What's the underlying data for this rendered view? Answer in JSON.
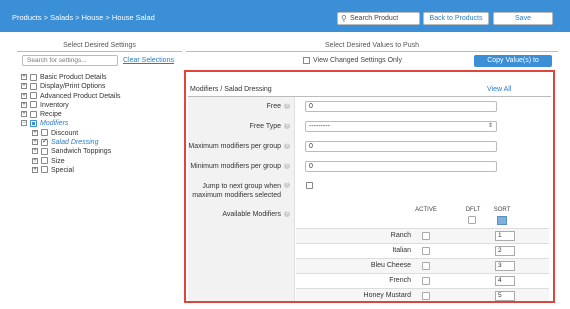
{
  "header": {
    "breadcrumb": "Products > Salads > House > House Salad",
    "search_label": "Search Product",
    "back_label": "Back to Products",
    "save_label": "Save"
  },
  "left": {
    "heading": "Select Desired Settings",
    "search_placeholder": "Search for settings...",
    "clear_label": "Clear Selections",
    "tree": [
      {
        "label": "Basic Product Details",
        "level": 0,
        "expander": "+",
        "state": "off"
      },
      {
        "label": "Display/Print Options",
        "level": 0,
        "expander": "+",
        "state": "off"
      },
      {
        "label": "Advanced Product Details",
        "level": 0,
        "expander": "+",
        "state": "off"
      },
      {
        "label": "Inventory",
        "level": 0,
        "expander": "+",
        "state": "off"
      },
      {
        "label": "Recipe",
        "level": 0,
        "expander": "+",
        "state": "off"
      },
      {
        "label": "Modifiers",
        "level": 0,
        "expander": "−",
        "state": "partial",
        "highlight": true
      },
      {
        "label": "Discount",
        "level": 1,
        "expander": "+",
        "state": "off"
      },
      {
        "label": "Salad Dressing",
        "level": 1,
        "expander": "+",
        "state": "checked",
        "highlight": true
      },
      {
        "label": "Sandwich Toppings",
        "level": 1,
        "expander": "+",
        "state": "off"
      },
      {
        "label": "Size",
        "level": 1,
        "expander": "+",
        "state": "off"
      },
      {
        "label": "Special",
        "level": 1,
        "expander": "+",
        "state": "off"
      }
    ]
  },
  "right": {
    "heading": "Select Desired Values to Push",
    "view_changed_label": "View Changed Settings Only",
    "copy_label": "Copy Value(s) to"
  },
  "panel": {
    "title": "Modifiers / Salad Dressing",
    "view_all": "View All",
    "fields": {
      "free_label": "Free",
      "free_value": "0",
      "free_type_label": "Free Type",
      "free_type_value": "---------",
      "max_label": "Maximum modifiers per group",
      "max_value": "0",
      "min_label": "Minimum modifiers per group",
      "min_value": "0",
      "jump_label_1": "Jump to next group when",
      "jump_label_2": "maximum modifiers selected",
      "available_label": "Available Modifiers"
    },
    "columns": {
      "active": "ACTIVE",
      "dflt": "DFLT",
      "sort": "SORT"
    },
    "modifiers": [
      {
        "name": "Ranch",
        "sort": "1"
      },
      {
        "name": "Italian",
        "sort": "2"
      },
      {
        "name": "Bleu Cheese",
        "sort": "3"
      },
      {
        "name": "French",
        "sort": "4"
      },
      {
        "name": "Honey Mustard",
        "sort": "5"
      }
    ]
  },
  "colors": {
    "accent": "#3a8fd6",
    "highlight_border": "#e0443b"
  }
}
